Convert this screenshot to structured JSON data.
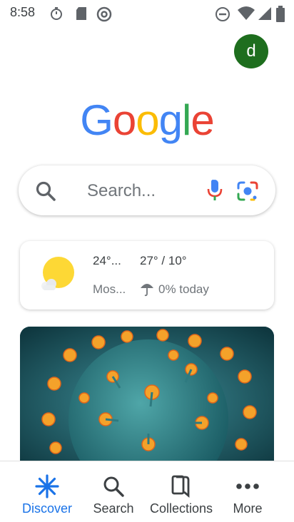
{
  "status_bar": {
    "time": "8:58"
  },
  "account": {
    "initial": "d",
    "color": "#1e6e1e"
  },
  "logo": {
    "letters": [
      "G",
      "o",
      "o",
      "g",
      "l",
      "e"
    ],
    "colors": [
      "#4285f4",
      "#ea4335",
      "#fbbc05",
      "#4285f4",
      "#34a853",
      "#ea4335"
    ]
  },
  "search": {
    "placeholder": "Search..."
  },
  "weather": {
    "temperature": "24°...",
    "condition": "Mos...",
    "high_low": "27° / 10°",
    "precipitation": "0% today"
  },
  "bottom_nav": {
    "items": [
      {
        "label": "Discover",
        "icon": "discover-icon",
        "active": true
      },
      {
        "label": "Search",
        "icon": "search-icon",
        "active": false
      },
      {
        "label": "Collections",
        "icon": "collections-icon",
        "active": false
      },
      {
        "label": "More",
        "icon": "more-icon",
        "active": false
      }
    ]
  },
  "colors": {
    "accent": "#1a73e8",
    "text_secondary": "#70757a"
  }
}
